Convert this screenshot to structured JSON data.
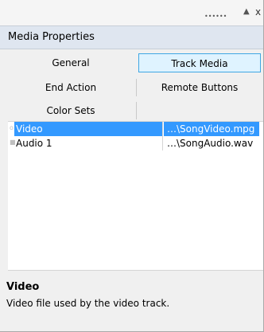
{
  "window": {
    "grip_icon": "grip-dots-icon",
    "pin_icon": "pin-icon",
    "close_icon": "close-icon",
    "pin_glyph": "▲",
    "close_glyph": "x",
    "grip_glyph": "••••••"
  },
  "panel": {
    "title": "Media Properties"
  },
  "tabs": {
    "general": "General",
    "track_media": "Track Media",
    "end_action": "End Action",
    "remote_buttons": "Remote Buttons",
    "color_sets": "Color Sets",
    "active_tab": "Track Media"
  },
  "list": {
    "rows": [
      {
        "name": "Video",
        "path": "…\\SongVideo.mpg",
        "selected": true
      },
      {
        "name": "Audio 1",
        "path": "…\\SongAudio.wav",
        "selected": false
      }
    ]
  },
  "description": {
    "title": "Video",
    "text": "Video file used by the video track."
  },
  "colors": {
    "accent": "#3fa7e3",
    "selection": "#3399ff",
    "header_bg": "#dfe6f0"
  }
}
